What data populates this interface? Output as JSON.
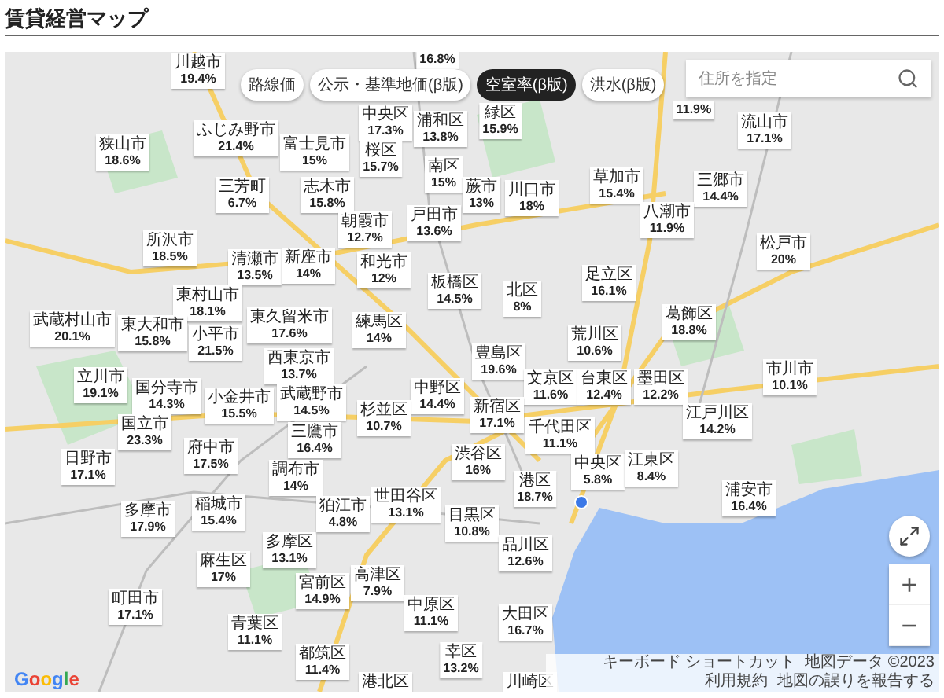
{
  "title": "賃貸経営マップ",
  "layer_buttons": [
    {
      "label": "路線価",
      "selected": false
    },
    {
      "label": "公示・基準地価(β版)",
      "selected": false
    },
    {
      "label": "空室率(β版)",
      "selected": true
    },
    {
      "label": "洪水(β版)",
      "selected": false
    }
  ],
  "search": {
    "placeholder": "住所を指定"
  },
  "map_labels": [
    {
      "name": "川越市",
      "value": "19.4%"
    },
    {
      "name": "狭山市",
      "value": "18.6%"
    },
    {
      "name": "富士見市",
      "value": "15%"
    },
    {
      "name": "ふじみ野市",
      "value": "21.4%"
    },
    {
      "name": "三芳町",
      "value": "6.7%"
    },
    {
      "name": "所沢市",
      "value": "18.5%"
    },
    {
      "name": "清瀬市",
      "value": "13.5%"
    },
    {
      "name": "新座市",
      "value": "14%"
    },
    {
      "name": "東村山市",
      "value": "18.1%"
    },
    {
      "name": "武蔵村山市",
      "value": "20.1%"
    },
    {
      "name": "東大和市",
      "value": "15.8%"
    },
    {
      "name": "東久留米市",
      "value": "17.6%"
    },
    {
      "name": "西東京市",
      "value": "13.7%"
    },
    {
      "name": "小平市",
      "value": "21.5%"
    },
    {
      "name": "立川市",
      "value": "19.1%"
    },
    {
      "name": "国分寺市",
      "value": "14.3%"
    },
    {
      "name": "小金井市",
      "value": "15.5%"
    },
    {
      "name": "武蔵野市",
      "value": "14.5%"
    },
    {
      "name": "三鷹市",
      "value": "16.4%"
    },
    {
      "name": "国立市",
      "value": "23.3%"
    },
    {
      "name": "府中市",
      "value": "17.5%"
    },
    {
      "name": "日野市",
      "value": "17.1%"
    },
    {
      "name": "調布市",
      "value": "14%"
    },
    {
      "name": "多摩市",
      "value": "17.9%"
    },
    {
      "name": "稲城市",
      "value": "15.4%"
    },
    {
      "name": "多摩区",
      "value": "13.1%"
    },
    {
      "name": "麻生区",
      "value": "17%"
    },
    {
      "name": "町田市",
      "value": "17.1%"
    },
    {
      "name": "青葉区",
      "value": "11.1%"
    },
    {
      "value": "16.8%"
    },
    {
      "name": "浦和区",
      "value": "13.8%"
    },
    {
      "name": "中央区",
      "value": "17.3%"
    },
    {
      "name": "緑区",
      "value": "15.9%"
    },
    {
      "name": "桜区",
      "value": "15.7%"
    },
    {
      "name": "南区",
      "value": "15%"
    },
    {
      "name": "志木市",
      "value": "15.8%"
    },
    {
      "name": "蕨市",
      "value": "13%"
    },
    {
      "name": "川口市",
      "value": "18%"
    },
    {
      "name": "戸田市",
      "value": "13.6%"
    },
    {
      "name": "朝霞市",
      "value": "12.7%"
    },
    {
      "name": "和光市",
      "value": "12%"
    },
    {
      "name": "板橋区",
      "value": "14.5%"
    },
    {
      "name": "北区",
      "value": "8%"
    },
    {
      "name": "練馬区",
      "value": "14%"
    },
    {
      "name": "草加市",
      "value": "15.4%"
    },
    {
      "name": "足立区",
      "value": "16.1%"
    },
    {
      "name": "荒川区",
      "value": "10.6%"
    },
    {
      "value": "11.9%"
    },
    {
      "name": "流山市",
      "value": "17.1%"
    },
    {
      "name": "三郷市",
      "value": "14.4%"
    },
    {
      "name": "八潮市",
      "value": "11.9%"
    },
    {
      "name": "松戸市",
      "value": "20%"
    },
    {
      "name": "葛飾区",
      "value": "18.8%"
    },
    {
      "name": "豊島区",
      "value": "19.6%"
    },
    {
      "name": "文京区",
      "value": "11.6%"
    },
    {
      "name": "台東区",
      "value": "12.4%"
    },
    {
      "name": "墨田区",
      "value": "12.2%"
    },
    {
      "name": "中野区",
      "value": "14.4%"
    },
    {
      "name": "杉並区",
      "value": "10.7%"
    },
    {
      "name": "新宿区",
      "value": "17.1%"
    },
    {
      "name": "千代田区",
      "value": "11.1%"
    },
    {
      "name": "中央区",
      "value": "5.8%"
    },
    {
      "name": "渋谷区",
      "value": "16%"
    },
    {
      "name": "港区",
      "value": "18.7%"
    },
    {
      "name": "江東区",
      "value": "8.4%"
    },
    {
      "name": "狛江市",
      "value": "4.8%"
    },
    {
      "name": "世田谷区",
      "value": "13.1%"
    },
    {
      "name": "目黒区",
      "value": "10.8%"
    },
    {
      "name": "品川区",
      "value": "12.6%"
    },
    {
      "name": "宮前区",
      "value": "14.9%"
    },
    {
      "name": "高津区",
      "value": "7.9%"
    },
    {
      "name": "中原区",
      "value": "11.1%"
    },
    {
      "name": "大田区",
      "value": "16.7%"
    },
    {
      "name": "都筑区",
      "value": "11.4%"
    },
    {
      "name": "幸区",
      "value": "13.2%"
    },
    {
      "name": "港北区"
    },
    {
      "name": "川崎区"
    },
    {
      "name": "市川市",
      "value": "10.1%"
    },
    {
      "name": "江戸川区",
      "value": "14.2%"
    },
    {
      "name": "浦安市",
      "value": "16.4%"
    }
  ],
  "map_footer": {
    "logo": "Google",
    "links": [
      "キーボード ショートカット",
      "地図データ ©2023",
      "利用規約",
      "地図の誤りを報告する"
    ]
  },
  "zoom_controls": [
    "+",
    "−"
  ]
}
